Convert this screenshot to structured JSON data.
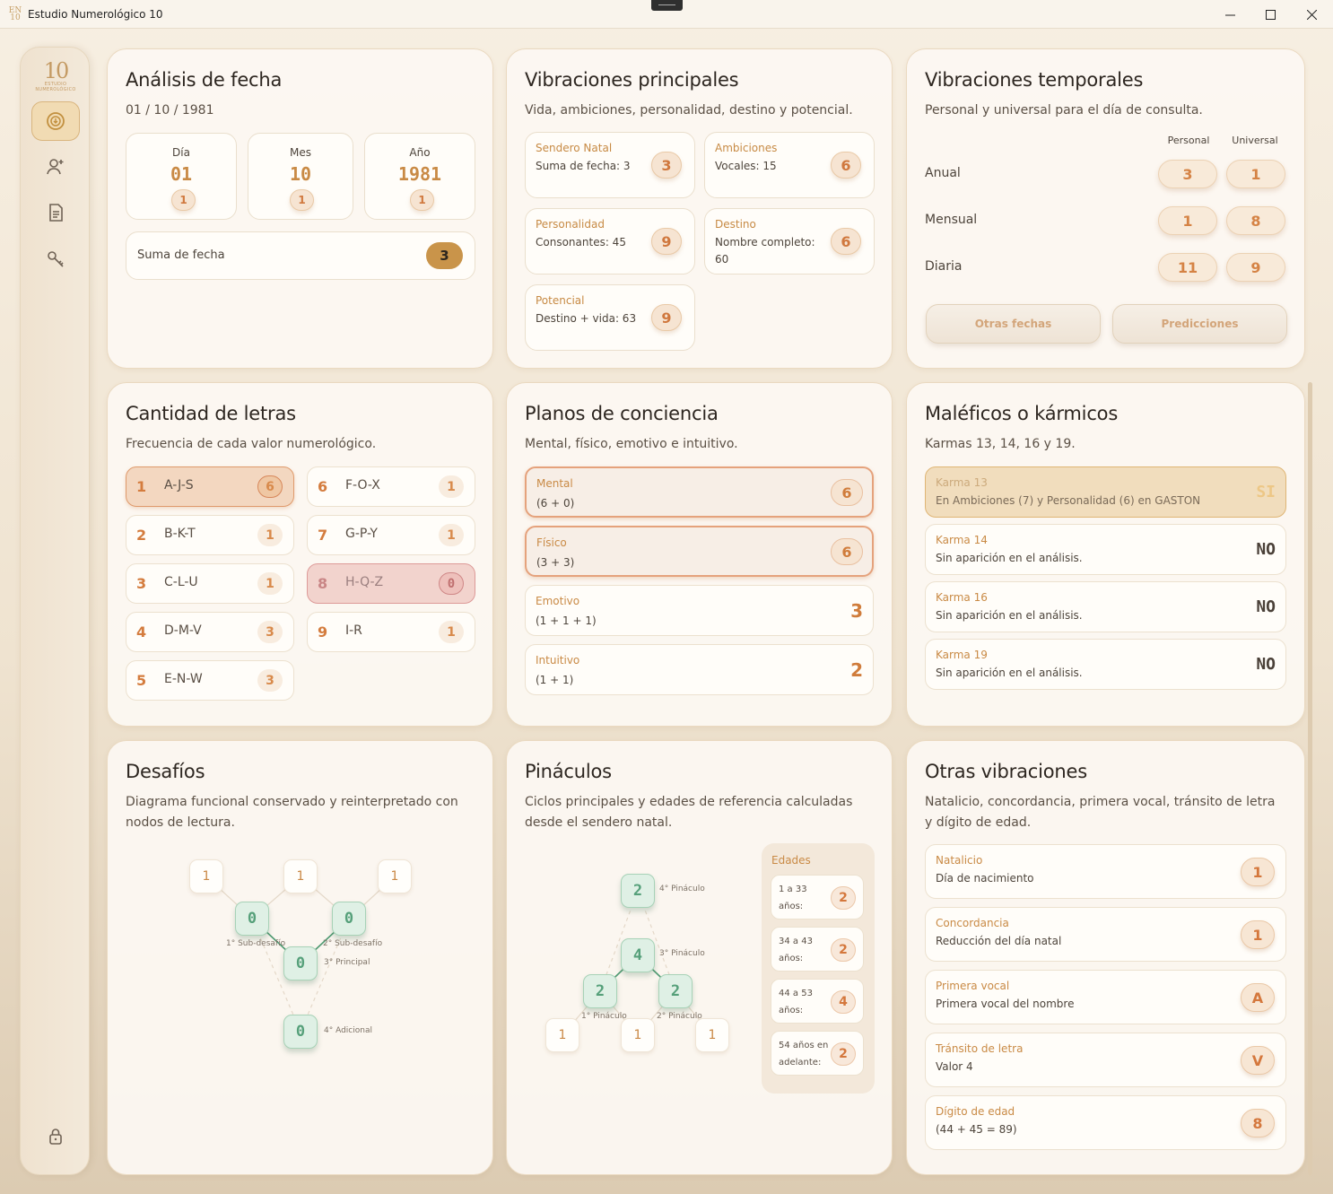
{
  "window": {
    "title": "Estudio Numerológico 10",
    "icon_text": "EN 10"
  },
  "logo": {
    "big": "10",
    "small": "ESTUDIO NUMEROLÓGICO"
  },
  "analisis": {
    "title": "Análisis de fecha",
    "date": "01 / 10 / 1981",
    "cells": [
      {
        "label": "Día",
        "value": "01",
        "reduced": "1"
      },
      {
        "label": "Mes",
        "value": "10",
        "reduced": "1"
      },
      {
        "label": "Año",
        "value": "1981",
        "reduced": "1"
      }
    ],
    "sum_label": "Suma de fecha",
    "sum_value": "3"
  },
  "principales": {
    "title": "Vibraciones principales",
    "subtitle": "Vida, ambiciones, personalidad, destino y potencial.",
    "items": [
      {
        "title": "Sendero Natal",
        "desc": "Suma de fecha: 3",
        "value": "3"
      },
      {
        "title": "Ambiciones",
        "desc": "Vocales: 15",
        "value": "6"
      },
      {
        "title": "Personalidad",
        "desc": "Consonantes: 45",
        "value": "9"
      },
      {
        "title": "Destino",
        "desc": "Nombre completo:",
        "desc2": "60",
        "value": "6"
      },
      {
        "title": "Potencial",
        "desc": "Destino + vida: 63",
        "value": "9"
      }
    ]
  },
  "temporales": {
    "title": "Vibraciones temporales",
    "subtitle": "Personal y universal para el día de consulta.",
    "col_personal": "Personal",
    "col_universal": "Universal",
    "rows": [
      {
        "label": "Anual",
        "personal": "3",
        "universal": "1"
      },
      {
        "label": "Mensual",
        "personal": "1",
        "universal": "8"
      },
      {
        "label": "Diaria",
        "personal": "11",
        "universal": "9"
      }
    ],
    "btn_otras": "Otras fechas",
    "btn_predicciones": "Predicciones"
  },
  "letras": {
    "title": "Cantidad de letras",
    "subtitle": "Frecuencia de cada valor numerológico.",
    "rows": [
      {
        "n": "1",
        "letters": "A-J-S",
        "count": "6"
      },
      {
        "n": "2",
        "letters": "B-K-T",
        "count": "1"
      },
      {
        "n": "3",
        "letters": "C-L-U",
        "count": "1"
      },
      {
        "n": "4",
        "letters": "D-M-V",
        "count": "3"
      },
      {
        "n": "5",
        "letters": "E-N-W",
        "count": "3"
      },
      {
        "n": "6",
        "letters": "F-O-X",
        "count": "1"
      },
      {
        "n": "7",
        "letters": "G-P-Y",
        "count": "1"
      },
      {
        "n": "8",
        "letters": "H-Q-Z",
        "count": "0"
      },
      {
        "n": "9",
        "letters": "I-R",
        "count": "1"
      }
    ]
  },
  "planos": {
    "title": "Planos de conciencia",
    "subtitle": "Mental, físico, emotivo e intuitivo.",
    "items": [
      {
        "title": "Mental",
        "formula": "(6 + 0)",
        "value": "6"
      },
      {
        "title": "Físico",
        "formula": "(3 + 3)",
        "value": "6"
      },
      {
        "title": "Emotivo",
        "formula": "(1 + 1 + 1)",
        "value": "3"
      },
      {
        "title": "Intuitivo",
        "formula": "(1 + 1)",
        "value": "2"
      }
    ]
  },
  "karmicos": {
    "title": "Maléficos o kármicos",
    "subtitle": "Karmas 13, 14, 16 y 19.",
    "items": [
      {
        "title": "Karma 13",
        "desc": "En Ambiciones (7) y Personalidad (6) en GASTON",
        "value": "SI"
      },
      {
        "title": "Karma 14",
        "desc": "Sin aparición en el análisis.",
        "value": "NO"
      },
      {
        "title": "Karma 16",
        "desc": "Sin aparición en el análisis.",
        "value": "NO"
      },
      {
        "title": "Karma 19",
        "desc": "Sin aparición en el análisis.",
        "value": "NO"
      }
    ]
  },
  "desafios": {
    "title": "Desafíos",
    "subtitle": "Diagrama funcional conservado y reinterpretado con nodos de lectura.",
    "top": [
      "1",
      "1",
      "1"
    ],
    "sub1": "0",
    "sub1_label": "1° Sub-desafío",
    "sub2": "0",
    "sub2_label": "2° Sub-desafío",
    "main": "0",
    "main_label": "3° Principal",
    "extra": "0",
    "extra_label": "4° Adicional"
  },
  "pinaculos": {
    "title": "Pináculos",
    "subtitle": "Ciclos principales y edades de referencia calculadas desde el sendero natal.",
    "p4": "2",
    "p4_label": "4° Pináculo",
    "p3": "4",
    "p3_label": "3° Pináculo",
    "p1": "2",
    "p1_label": "1° Pináculo",
    "p2": "2",
    "p2_label": "2° Pináculo",
    "base": [
      "1",
      "1",
      "1"
    ],
    "edades_title": "Edades",
    "edades": [
      {
        "a": "1 a 33",
        "b": "años:",
        "v": "2"
      },
      {
        "a": "34 a 43",
        "b": "años:",
        "v": "2"
      },
      {
        "a": "44 a 53",
        "b": "años:",
        "v": "4"
      },
      {
        "a": "54 años en",
        "b": "adelante:",
        "v": "2"
      }
    ]
  },
  "otras": {
    "title": "Otras vibraciones",
    "subtitle": "Natalicio, concordancia, primera vocal, tránsito de letra y dígito de edad.",
    "items": [
      {
        "title": "Natalicio",
        "desc": "Día de nacimiento",
        "value": "1"
      },
      {
        "title": "Concordancia",
        "desc": "Reducción del día natal",
        "value": "1"
      },
      {
        "title": "Primera vocal",
        "desc": "Primera vocal del nombre",
        "value": "A"
      },
      {
        "title": "Tránsito de letra",
        "desc": "Valor 4",
        "value": "V"
      },
      {
        "title": "Dígito de edad",
        "desc": "(44 + 45 = 89)",
        "value": "8"
      }
    ]
  }
}
